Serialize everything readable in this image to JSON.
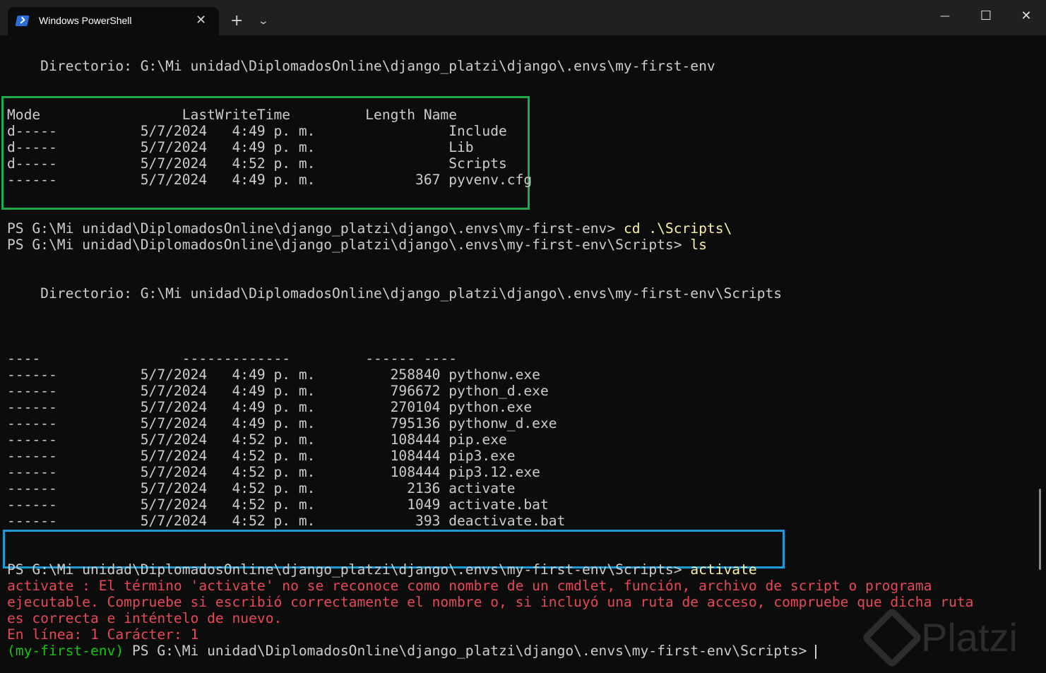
{
  "window": {
    "tab_title": "Windows PowerShell",
    "tab_close": "✕",
    "new_tab": "+",
    "dropdown": "⌄",
    "minimize": "—",
    "maximize": "☐",
    "close": "✕"
  },
  "lines": [
    "    Directorio: G:\\Mi unidad\\DiplomadosOnline\\django_platzi\\django\\.envs\\my-first-env",
    "",
    "",
    "Mode                 LastWriteTime         Length Name",
    "d-----          5/7/2024   4:49 p. m.                Include",
    "d-----          5/7/2024   4:49 p. m.                Lib",
    "d-----          5/7/2024   4:52 p. m.                Scripts",
    "------          5/7/2024   4:49 p. m.            367 pyvenv.cfg",
    "",
    "",
    "PS G:\\Mi unidad\\DiplomadosOnline\\django_platzi\\django\\.envs\\my-first-env> ",
    "PS G:\\Mi unidad\\DiplomadosOnline\\django_platzi\\django\\.envs\\my-first-env\\Scripts> ",
    "",
    "",
    "    Directorio: G:\\Mi unidad\\DiplomadosOnline\\django_platzi\\django\\.envs\\my-first-env\\Scripts",
    "",
    "",
    "",
    "----                 -------------         ------ ----",
    "------          5/7/2024   4:49 p. m.         258840 pythonw.exe",
    "------          5/7/2024   4:49 p. m.         796672 python_d.exe",
    "------          5/7/2024   4:49 p. m.         270104 python.exe",
    "------          5/7/2024   4:49 p. m.         795136 pythonw_d.exe",
    "------          5/7/2024   4:52 p. m.         108444 pip.exe",
    "------          5/7/2024   4:52 p. m.         108444 pip3.exe",
    "------          5/7/2024   4:52 p. m.         108444 pip3.12.exe",
    "------          5/7/2024   4:52 p. m.           2136 activate",
    "------          5/7/2024   4:52 p. m.           1049 activate.bat",
    "------          5/7/2024   4:52 p. m.            393 deactivate.bat",
    "",
    "",
    "PS G:\\Mi unidad\\DiplomadosOnline\\django_platzi\\django\\.envs\\my-first-env\\Scripts> ",
    "activate : El término 'activate' no se reconoce como nombre de un cmdlet, función, archivo de script o programa",
    "ejecutable. Compruebe si escribió correctamente el nombre o, si incluyó una ruta de acceso, compruebe que dicha ruta",
    "es correcta e inténtelo de nuevo.",
    "En línea: 1 Carácter: 1",
    " PS G:\\Mi unidad\\DiplomadosOnline\\django_platzi\\django\\.envs\\my-first-env\\Scripts> "
  ],
  "commands": {
    "cd": "cd .\\Scripts\\",
    "ls": "ls",
    "activate": "activate",
    "venv_prefix": "(my-first-env)"
  },
  "watermark": "Platzi",
  "colors": {
    "background": "#0c0c0c",
    "text": "#cccccc",
    "command": "#f9f1a5",
    "error": "#e74856",
    "venv": "#16c60c",
    "highlight_green": "#20a84a",
    "highlight_blue": "#1c9ad6"
  }
}
